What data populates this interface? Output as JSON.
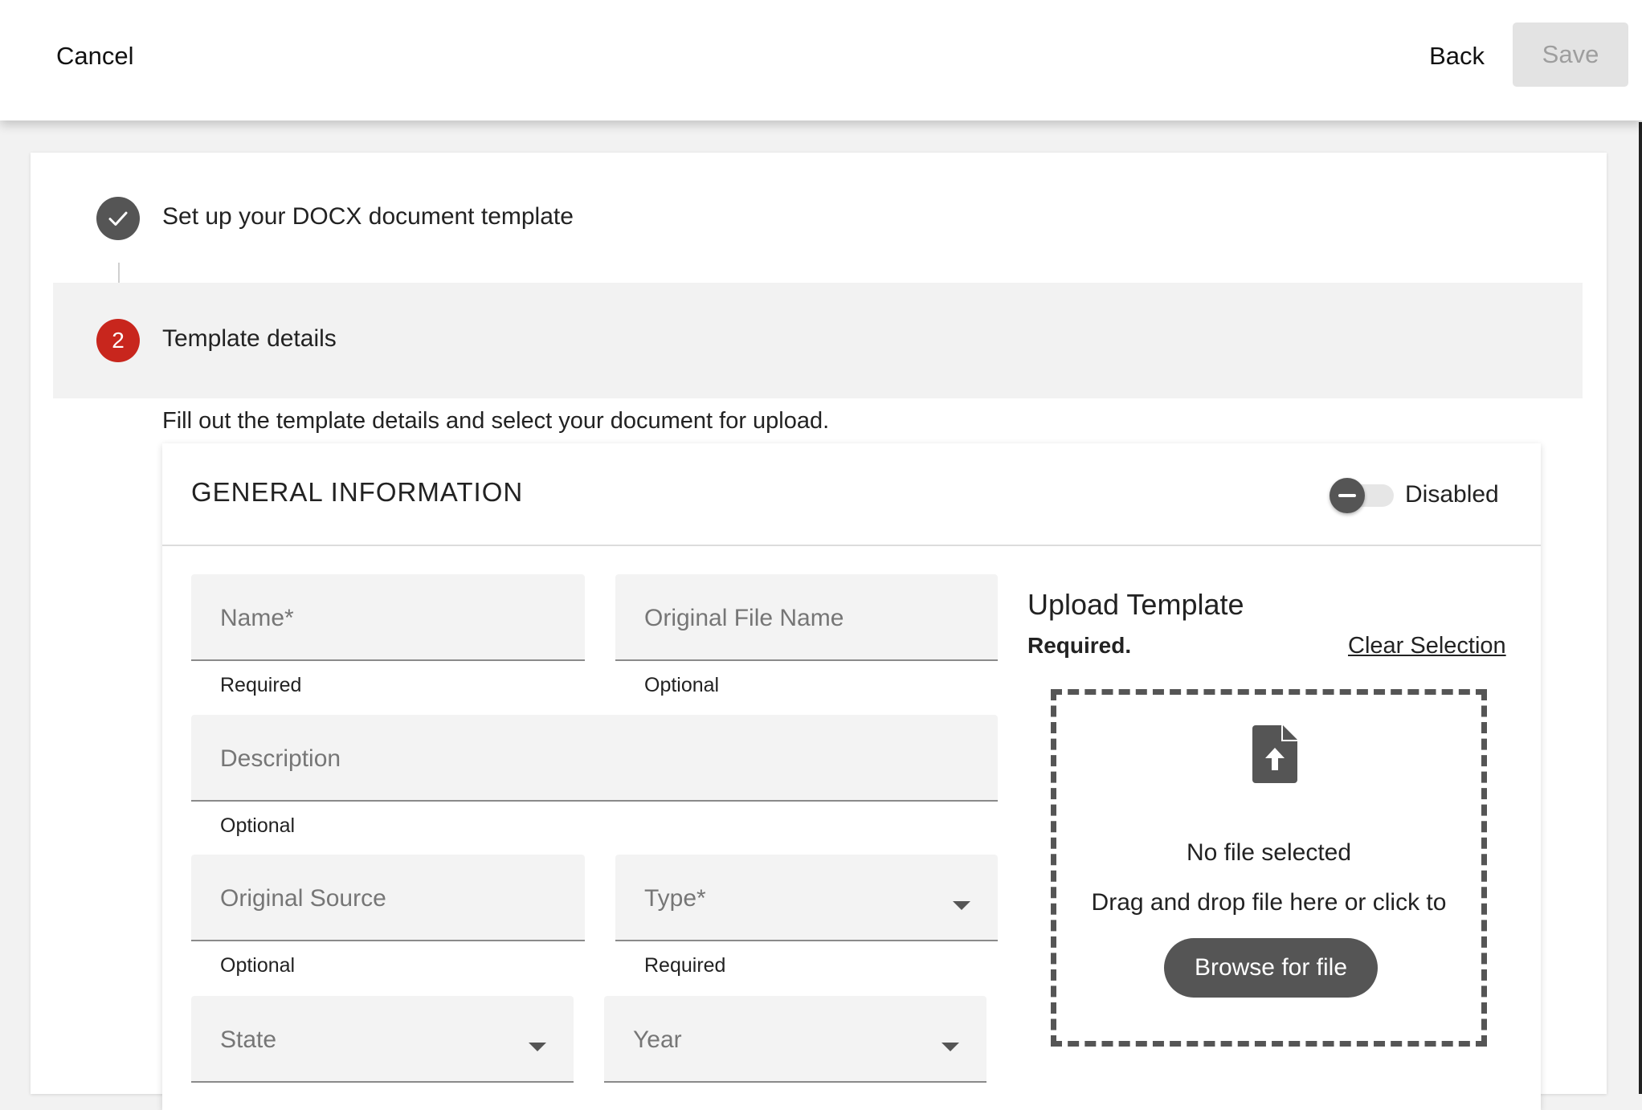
{
  "header": {
    "cancel_label": "Cancel",
    "back_label": "Back",
    "save_label": "Save"
  },
  "steps": [
    {
      "label": "Set up your DOCX document template",
      "status": "complete",
      "icon": "check-icon"
    },
    {
      "label": "Template details",
      "number": "2",
      "status": "active"
    }
  ],
  "instructions": "Fill out the template details and select your document for upload.",
  "general_info": {
    "title": "GENERAL INFORMATION",
    "toggle_label": "Disabled",
    "fields": {
      "name": {
        "placeholder": "Name*",
        "helper": "Required"
      },
      "original_file_name": {
        "placeholder": "Original File Name",
        "helper": "Optional"
      },
      "description": {
        "placeholder": "Description",
        "helper": "Optional"
      },
      "original_source": {
        "placeholder": "Original Source",
        "helper": "Optional"
      },
      "type": {
        "placeholder": "Type*",
        "helper": "Required"
      },
      "state": {
        "placeholder": "State"
      },
      "year": {
        "placeholder": "Year"
      }
    }
  },
  "upload": {
    "title": "Upload Template",
    "required_label": "Required.",
    "clear_label": "Clear Selection",
    "no_file_text": "No file selected",
    "drag_text": "Drag and drop file here or click to",
    "browse_label": "Browse for file",
    "icon": "file-upload-icon"
  },
  "colors": {
    "active_step": "#c8261d",
    "complete_step": "#555555",
    "save_disabled_bg": "#e3e3e3",
    "browse_bg": "#555555"
  }
}
